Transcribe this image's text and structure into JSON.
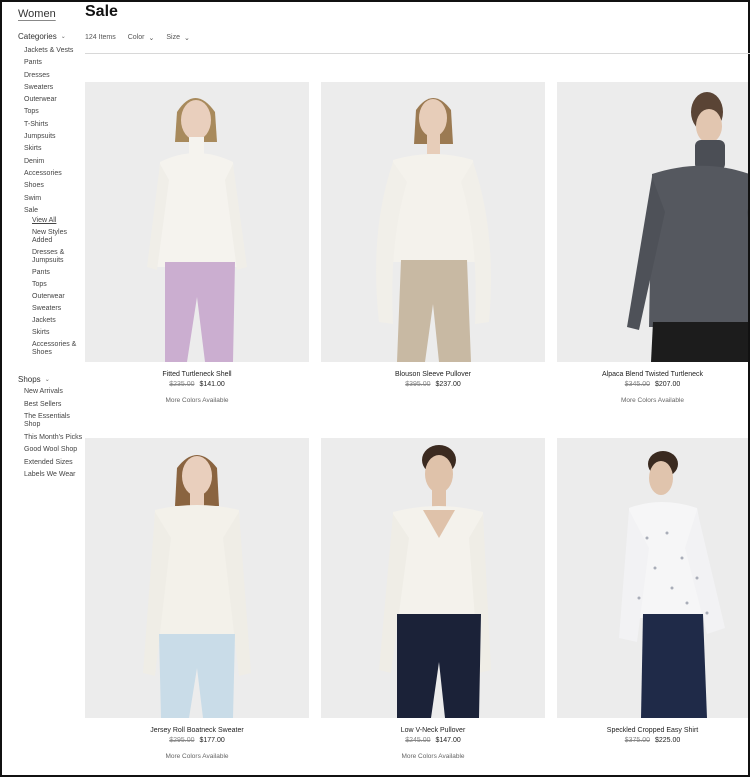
{
  "sidebar": {
    "root": "Women",
    "categories_label": "Categories",
    "categories": [
      "Jackets & Vests",
      "Pants",
      "Dresses",
      "Sweaters",
      "Outerwear",
      "Tops",
      "T-Shirts",
      "Jumpsuits",
      "Skirts",
      "Denim",
      "Accessories",
      "Shoes",
      "Swim",
      "Sale"
    ],
    "sale_sub": [
      "View All",
      "New Styles Added",
      "Dresses & Jumpsuits",
      "Pants",
      "Tops",
      "Outerwear",
      "Sweaters",
      "Jackets",
      "Skirts",
      "Accessories & Shoes"
    ],
    "shops_label": "Shops",
    "shops": [
      "New Arrivals",
      "Best Sellers",
      "The Essentials Shop",
      "This Month's Picks",
      "Good Wool Shop",
      "Extended Sizes",
      "Labels We Wear"
    ]
  },
  "header": {
    "title": "Sale",
    "count": "124 Items",
    "color_label": "Color",
    "size_label": "Size"
  },
  "products": [
    {
      "name": "Fitted Turtleneck Shell",
      "old_price": "$235.00",
      "price": "$141.00",
      "more": "More Colors Available"
    },
    {
      "name": "Blouson Sleeve Pullover",
      "old_price": "$395.00",
      "price": "$237.00",
      "more": ""
    },
    {
      "name": "Alpaca Blend Twisted Turtleneck",
      "old_price": "$345.00",
      "price": "$207.00",
      "more": "More Colors Available"
    },
    {
      "name": "Jersey Roll Boatneck Sweater",
      "old_price": "$295.00",
      "price": "$177.00",
      "more": "More Colors Available"
    },
    {
      "name": "Low V-Neck Pullover",
      "old_price": "$245.00",
      "price": "$147.00",
      "more": "More Colors Available"
    },
    {
      "name": "Speckled Cropped Easy Shirt",
      "old_price": "$375.00",
      "price": "$225.00",
      "more": ""
    }
  ]
}
